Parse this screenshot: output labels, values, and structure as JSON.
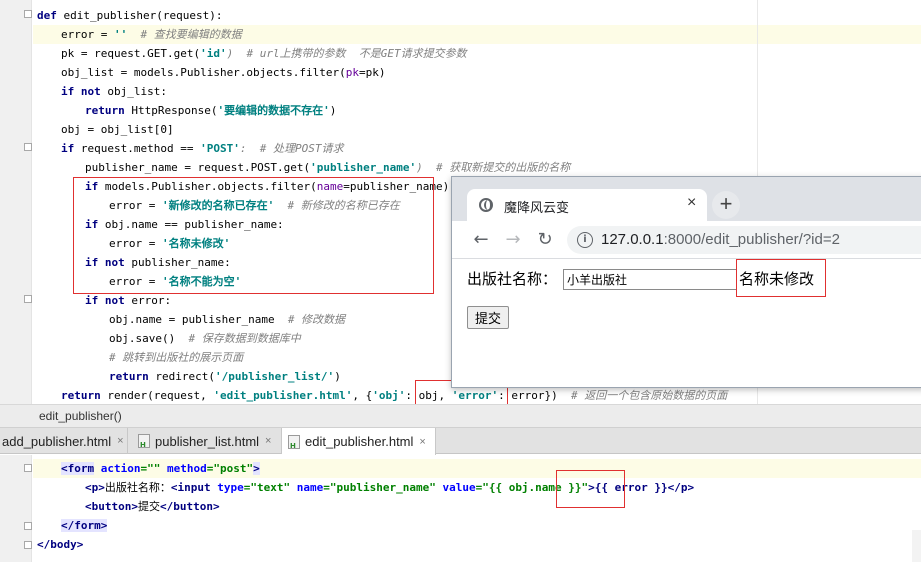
{
  "python_editor": {
    "lines": [
      {
        "indent": 0,
        "parts": [
          {
            "t": "def ",
            "c": "kw"
          },
          {
            "t": "edit_publisher(request):",
            "c": ""
          }
        ]
      },
      {
        "indent": 1,
        "parts": [
          {
            "t": "error = ",
            "c": ""
          },
          {
            "t": "''",
            "c": "str"
          },
          {
            "t": "  # 查找要编辑的数据",
            "c": "cm"
          }
        ]
      },
      {
        "indent": 1,
        "parts": [
          {
            "t": "pk = request.GET.get(",
            "c": ""
          },
          {
            "t": "'id'",
            "c": "str"
          },
          {
            "t": ")  # url上携带的参数  不是GET请求提交参数",
            "c": "cm"
          }
        ]
      },
      {
        "indent": 1,
        "parts": [
          {
            "t": "obj_list = models.Publisher.objects.filter(",
            "c": ""
          },
          {
            "t": "pk",
            "c": "kwarg"
          },
          {
            "t": "=pk)",
            "c": ""
          }
        ]
      },
      {
        "indent": 1,
        "parts": [
          {
            "t": "if not ",
            "c": "kw"
          },
          {
            "t": "obj_list:",
            "c": ""
          }
        ]
      },
      {
        "indent": 2,
        "parts": [
          {
            "t": "return ",
            "c": "kw"
          },
          {
            "t": "HttpResponse(",
            "c": ""
          },
          {
            "t": "'要编辑的数据不存在'",
            "c": "str"
          },
          {
            "t": ")",
            "c": ""
          }
        ]
      },
      {
        "indent": 1,
        "parts": [
          {
            "t": "obj = obj_list[0]",
            "c": ""
          }
        ]
      },
      {
        "indent": 1,
        "parts": [
          {
            "t": "if ",
            "c": "kw"
          },
          {
            "t": "request.method == ",
            "c": ""
          },
          {
            "t": "'POST'",
            "c": "str"
          },
          {
            "t": ":  # 处理POST请求",
            "c": "cm"
          }
        ]
      },
      {
        "indent": 2,
        "parts": [
          {
            "t": "publisher_name = request.POST.get(",
            "c": ""
          },
          {
            "t": "'publisher_name'",
            "c": "str"
          },
          {
            "t": ")  # 获取新提交的出版的名称",
            "c": "cm"
          }
        ]
      },
      {
        "indent": 2,
        "parts": [
          {
            "t": "if ",
            "c": "kw"
          },
          {
            "t": "models.Publisher.objects.filter(",
            "c": ""
          },
          {
            "t": "name",
            "c": "kwarg"
          },
          {
            "t": "=publisher_name):",
            "c": ""
          }
        ]
      },
      {
        "indent": 3,
        "parts": [
          {
            "t": "error = ",
            "c": ""
          },
          {
            "t": "'新修改的名称已存在'",
            "c": "str"
          },
          {
            "t": "  # 新修改的名称已存在",
            "c": "cm"
          }
        ]
      },
      {
        "indent": 2,
        "parts": [
          {
            "t": "if ",
            "c": "kw"
          },
          {
            "t": "obj.name == publisher_name:",
            "c": ""
          }
        ]
      },
      {
        "indent": 3,
        "parts": [
          {
            "t": "error = ",
            "c": ""
          },
          {
            "t": "'名称未修改'",
            "c": "str"
          }
        ]
      },
      {
        "indent": 2,
        "parts": [
          {
            "t": "if not ",
            "c": "kw"
          },
          {
            "t": "publisher_name:",
            "c": ""
          }
        ]
      },
      {
        "indent": 3,
        "parts": [
          {
            "t": "error = ",
            "c": ""
          },
          {
            "t": "'名称不能为空'",
            "c": "str"
          }
        ]
      },
      {
        "indent": 2,
        "parts": [
          {
            "t": "if not ",
            "c": "kw"
          },
          {
            "t": "error:",
            "c": ""
          }
        ]
      },
      {
        "indent": 3,
        "parts": [
          {
            "t": "obj.name = publisher_name  ",
            "c": ""
          },
          {
            "t": "# 修改数据",
            "c": "cm"
          }
        ]
      },
      {
        "indent": 3,
        "parts": [
          {
            "t": "obj.save()  ",
            "c": ""
          },
          {
            "t": "# 保存数据到数据库中",
            "c": "cm"
          }
        ]
      },
      {
        "indent": 3,
        "parts": [
          {
            "t": "# 跳转到出版社的展示页面",
            "c": "cm"
          }
        ]
      },
      {
        "indent": 3,
        "parts": [
          {
            "t": "return ",
            "c": "kw"
          },
          {
            "t": "redirect(",
            "c": ""
          },
          {
            "t": "'/publisher_list/'",
            "c": "str"
          },
          {
            "t": ")",
            "c": ""
          }
        ]
      },
      {
        "indent": 1,
        "parts": [
          {
            "t": "return ",
            "c": "kw"
          },
          {
            "t": "render(request, ",
            "c": ""
          },
          {
            "t": "'edit_publisher.html'",
            "c": "str"
          },
          {
            "t": ", {",
            "c": ""
          },
          {
            "t": "'obj'",
            "c": "str"
          },
          {
            "t": ": obj, ",
            "c": ""
          },
          {
            "t": "'error'",
            "c": "str"
          },
          {
            "t": ": error})  ",
            "c": ""
          },
          {
            "t": "# 返回一个包含原始数据的页面",
            "c": "cm"
          }
        ]
      }
    ]
  },
  "breadcrumb": {
    "label": "edit_publisher()"
  },
  "tabs": [
    {
      "label": "add_publisher.html",
      "active": false
    },
    {
      "label": "publisher_list.html",
      "active": false
    },
    {
      "label": "edit_publisher.html",
      "active": true
    }
  ],
  "tab_close_glyph": "×",
  "html_editor": {
    "lines": [
      {
        "indent": 1,
        "parts": [
          {
            "t": "<form",
            "c": "tg tgs"
          },
          {
            "t": " action",
            "c": "at"
          },
          {
            "t": "=\"\"",
            "c": "av"
          },
          {
            "t": " method",
            "c": "at"
          },
          {
            "t": "=\"post\"",
            "c": "av"
          },
          {
            "t": ">",
            "c": "tg tgs"
          }
        ]
      },
      {
        "indent": 2,
        "parts": [
          {
            "t": "<p>",
            "c": "tg"
          },
          {
            "t": "出版社名称：",
            "c": ""
          },
          {
            "t": "<input",
            "c": "tg"
          },
          {
            "t": " type",
            "c": "at"
          },
          {
            "t": "=\"text\"",
            "c": "av"
          },
          {
            "t": " name",
            "c": "at"
          },
          {
            "t": "=\"publisher_name\"",
            "c": "av"
          },
          {
            "t": " value",
            "c": "at"
          },
          {
            "t": "=\"{{ obj.name }}\"",
            "c": "av"
          },
          {
            "t": ">",
            "c": "tg"
          },
          {
            "t": "{{ error }}",
            "c": "tpl"
          },
          {
            "t": "</p>",
            "c": "tg"
          }
        ]
      },
      {
        "indent": 2,
        "parts": [
          {
            "t": "<button>",
            "c": "tg"
          },
          {
            "t": "提交",
            "c": ""
          },
          {
            "t": "</button>",
            "c": "tg"
          }
        ]
      },
      {
        "indent": 1,
        "parts": [
          {
            "t": "</form>",
            "c": "tg tgs"
          }
        ]
      },
      {
        "indent": 0,
        "parts": [
          {
            "t": "</body>",
            "c": "tg"
          }
        ]
      }
    ]
  },
  "browser": {
    "tab_title": "魔降风云变",
    "tab_close": "×",
    "new_tab": "+",
    "back": "←",
    "forward": "→",
    "reload": "↻",
    "info": "i",
    "url_host": "127.0.0.1",
    "url_rest": ":8000/edit_publisher/?id=2",
    "form_label": "出版社名称：",
    "input_value": "小羊出版社",
    "error_text": "名称未修改",
    "submit_label": "提交"
  },
  "colors": {
    "keyword": "#000080",
    "string": "#008080",
    "comment": "#808080",
    "annotation_box": "#e03030"
  }
}
